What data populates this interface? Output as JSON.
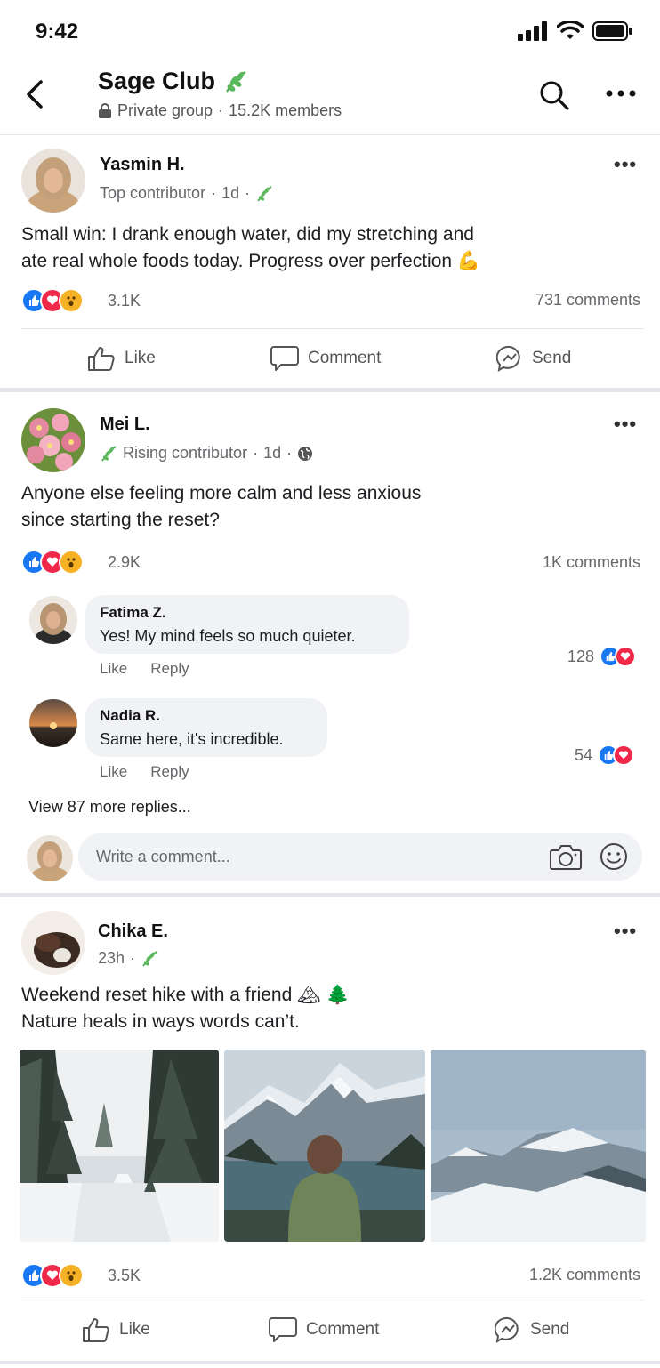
{
  "status_bar": {
    "time": "9:42"
  },
  "header": {
    "group_name": "Sage Club",
    "privacy": "Private group",
    "separator": "·",
    "members": "15.2K members"
  },
  "posts": [
    {
      "author": "Yasmin H.",
      "badge": "Top contributor",
      "time": "1d",
      "text_line1": "Small win: I drank enough water, did my stretching and",
      "text_line2": "ate real whole foods today. Progress over perfection",
      "reaction_count": "3.1K",
      "comment_count": "731 comments"
    },
    {
      "author": "Mei L.",
      "badge": "Rising contributor",
      "time": "1d",
      "text_line1": "Anyone else feeling more calm and less anxious",
      "text_line2": "since starting the reset?",
      "reaction_count": "2.9K",
      "comment_count": "1K comments",
      "comments": [
        {
          "name": "Fatima Z.",
          "text": "Yes! My mind feels so much quieter.",
          "like": "Like",
          "reply": "Reply",
          "count": "128"
        },
        {
          "name": "Nadia R.",
          "text": "Same here, it's incredible.",
          "like": "Like",
          "reply": "Reply",
          "count": "54"
        }
      ],
      "view_more": "View 87 more replies...",
      "write_placeholder": "Write a comment..."
    },
    {
      "author": "Chika E.",
      "time": "23h",
      "text_line1": "Weekend reset hike with a friend",
      "text_line2": "Nature heals in ways words can’t.",
      "reaction_count": "3.5K",
      "comment_count": "1.2K comments"
    }
  ],
  "actions": {
    "like": "Like",
    "comment": "Comment",
    "send": "Send"
  },
  "colors": {
    "like_blue": "#1877f2",
    "love_red": "#f02849",
    "wow_yellow": "#f7b125",
    "leaf_green": "#4caf50"
  }
}
